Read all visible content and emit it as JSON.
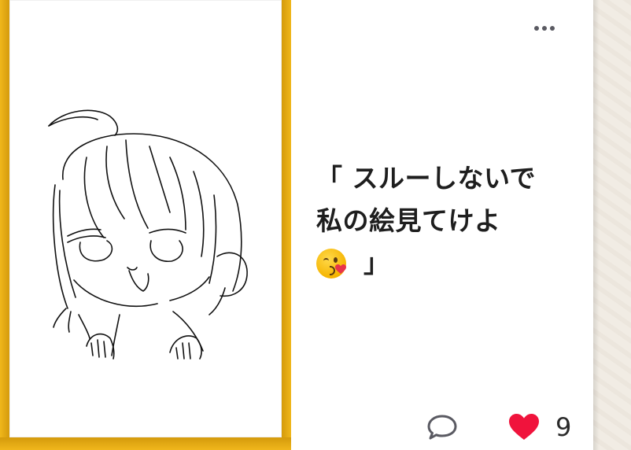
{
  "post": {
    "caption_line1": "「 スルーしないで",
    "caption_line2": "私の絵見てけよ",
    "caption_close": "」",
    "caption_emoji": "face-blowing-a-kiss",
    "like_count": "9"
  },
  "icons": {
    "more": "more-horizontal-icon",
    "comment": "comment-bubble-icon",
    "like": "heart-icon"
  },
  "colors": {
    "frame": "#e9aa10",
    "like": "#f0133c",
    "text": "#1e1e1e",
    "icon": "#5a5a62"
  }
}
